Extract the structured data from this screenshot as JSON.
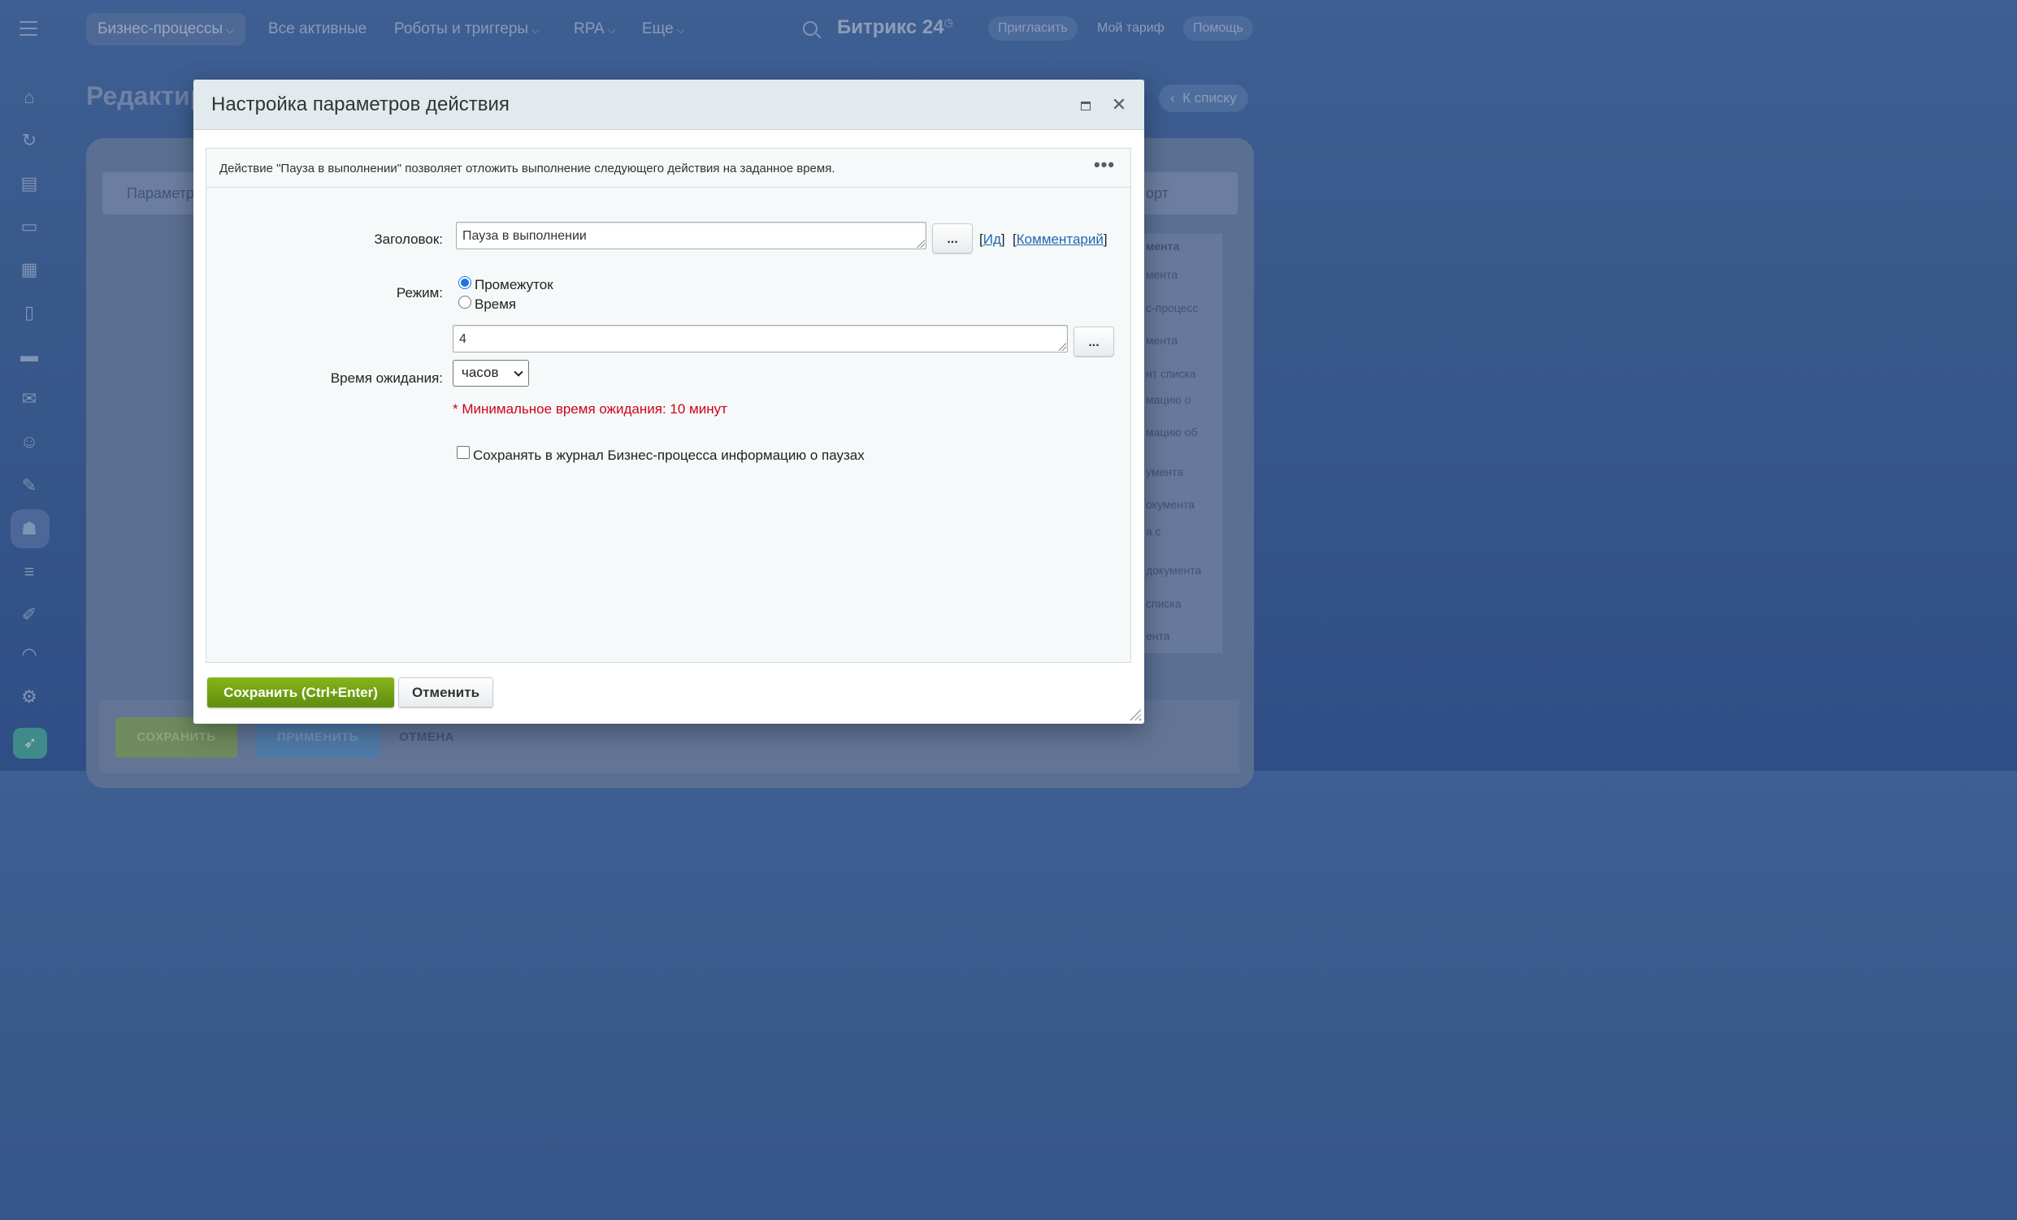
{
  "topnav": {
    "tabs": [
      {
        "label": "Бизнес-процессы"
      },
      {
        "label": "Все активные"
      },
      {
        "label": "Роботы и триггеры"
      },
      {
        "label": "RPA"
      },
      {
        "label": "Еще"
      }
    ],
    "brand": "Битрикс 24",
    "invite": "Пригласить",
    "tariff": "Мой тариф",
    "help": "Помощь"
  },
  "background": {
    "page_title": "Редактир",
    "back_link": "К списку",
    "tab_left": "Параметр",
    "tab_right": "орт",
    "list_header": "мента",
    "list_items": [
      "мента",
      "с-процесс",
      "мента",
      "нт списка",
      "мацию о",
      "мацию об",
      "умента",
      "окумента",
      "а с",
      "документа",
      "списка",
      "ента"
    ],
    "save_btn": "СОХРАНИТЬ",
    "apply_btn": "ПРИМЕНИТЬ",
    "cancel_btn": "ОТМЕНА"
  },
  "dialog": {
    "title": "Настройка параметров действия",
    "description": "Действие \"Пауза в выполнении\" позволяет отложить выполнение следующего действия на заданное время.",
    "title_label": "Заголовок:",
    "title_value": "Пауза в выполнении",
    "dots": "...",
    "id_link": "Ид",
    "comment_link": "Комментарий",
    "mode_label": "Режим:",
    "mode_options": [
      "Промежуток",
      "Время"
    ],
    "mode_selected": "Промежуток",
    "wait_label": "Время ожидания:",
    "wait_value": "4",
    "wait_unit": "часов",
    "min_hint": "* Минимальное время ожидания: 10 минут",
    "log_checkbox_label": "Сохранять в журнал Бизнес-процесса информацию о паузах",
    "log_checked": false,
    "save_button": "Сохранить (Ctrl+Enter)",
    "cancel_button": "Отменить"
  },
  "colors": {
    "save_button": "#6f9f14",
    "hint_text": "#d0021b",
    "link": "#2067b0",
    "radio_checked": "#1a73e8"
  }
}
